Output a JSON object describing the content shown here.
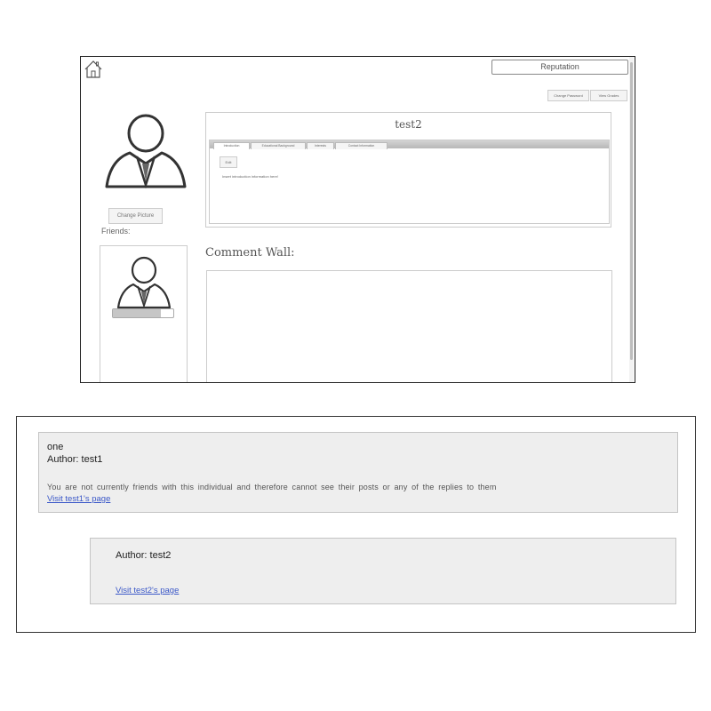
{
  "header": {
    "home_icon": "home-icon",
    "reputation_label": "Reputation",
    "change_password_label": "Change Password",
    "view_grades_label": "View Grades"
  },
  "profile": {
    "name": "test2",
    "avatar_icon": "user-avatar-icon",
    "change_picture_label": "Change Picture",
    "tabs": [
      {
        "label": "Introduction"
      },
      {
        "label": "Educational Background"
      },
      {
        "label": "Interests"
      },
      {
        "label": "Contact Information"
      }
    ],
    "edit_label": "Edit",
    "intro_text": "Insert introduction information here!"
  },
  "friends": {
    "label": "Friends:",
    "reputation_fraction": 0.8
  },
  "comment_wall": {
    "heading": "Comment Wall:"
  },
  "posts": [
    {
      "title": "one",
      "author": "Author: test1",
      "note": "You are not currently friends with this individual and therefore cannot see their posts or any of the replies to them",
      "link": "Visit test1's page"
    },
    {
      "author": "Author: test2",
      "link": "Visit test2's page"
    }
  ],
  "colors": {
    "link": "#3b58c8",
    "post_bg": "#eeeeee"
  }
}
